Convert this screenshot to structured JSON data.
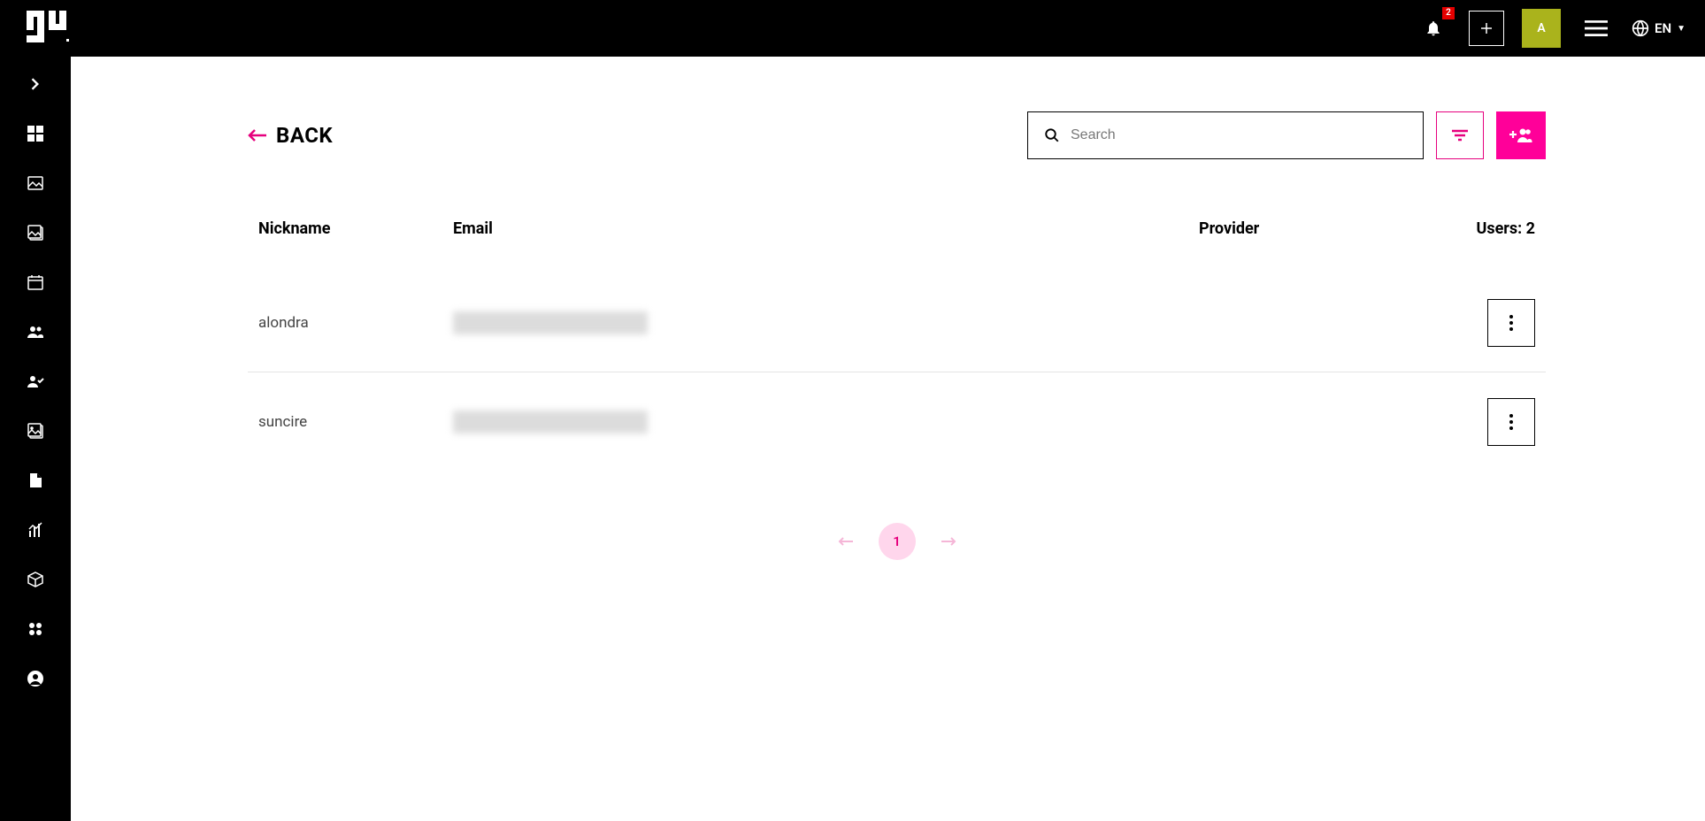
{
  "header": {
    "notif_count": "2",
    "avatar_initial": "A",
    "language": "EN"
  },
  "back_label": "BACK",
  "search": {
    "placeholder": "Search",
    "value": ""
  },
  "columns": {
    "nickname": "Nickname",
    "email": "Email",
    "provider": "Provider",
    "users": "Users: 2"
  },
  "rows": [
    {
      "nickname": "alondra",
      "email": "",
      "provider": ""
    },
    {
      "nickname": "suncire",
      "email": "",
      "provider": ""
    }
  ],
  "pagination": {
    "current": "1"
  }
}
